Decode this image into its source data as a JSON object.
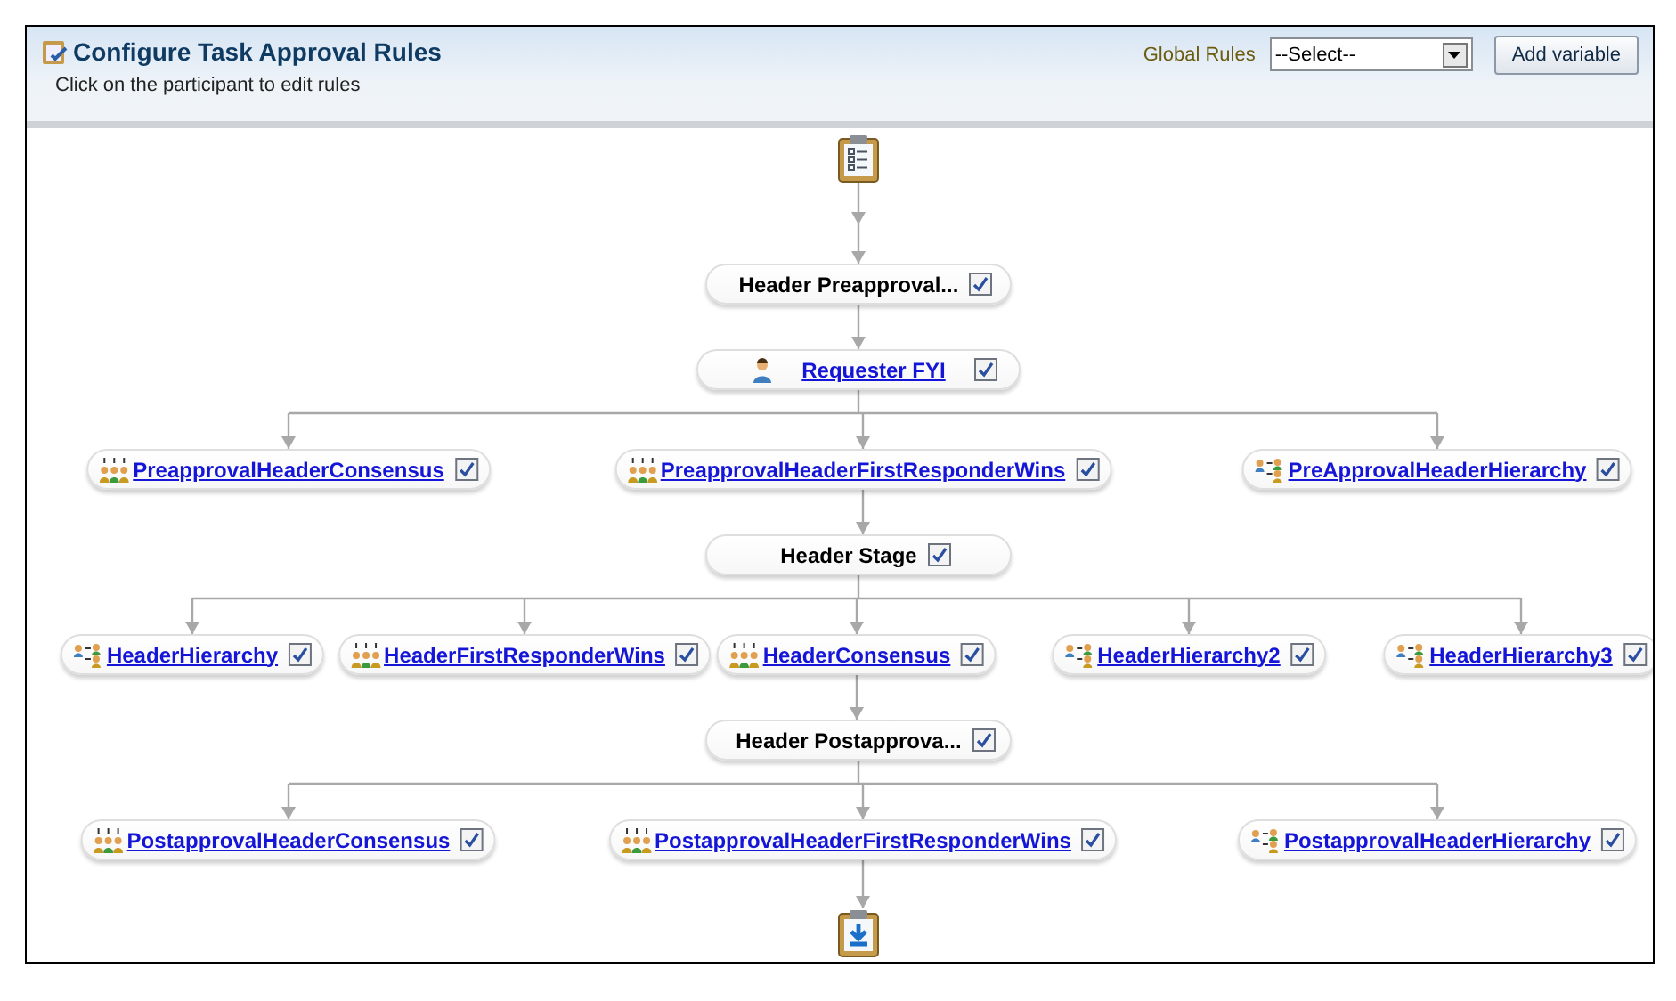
{
  "header": {
    "title": "Configure Task Approval Rules",
    "subtitle": "Click on the participant to edit rules",
    "global_rules": {
      "label": "Global Rules",
      "value": "--Select--"
    },
    "add_button": "Add variable"
  },
  "flow": [
    {
      "kind": "start"
    },
    {
      "kind": "stage",
      "label": "Header Preapproval...",
      "checked": true
    },
    {
      "kind": "participants",
      "items": [
        {
          "kind": "single",
          "label": "Requester FYI",
          "checked": true
        }
      ]
    },
    {
      "kind": "participants",
      "items": [
        {
          "kind": "parallel",
          "label": "PreapprovalHeaderConsensus",
          "checked": true
        },
        {
          "kind": "parallel",
          "label": "PreapprovalHeaderFirstResponderWins",
          "checked": true
        },
        {
          "kind": "hierarchy",
          "label": "PreApprovalHeaderHierarchy",
          "checked": true
        }
      ]
    },
    {
      "kind": "stage",
      "label": "Header Stage",
      "checked": true
    },
    {
      "kind": "participants",
      "items": [
        {
          "kind": "hierarchy",
          "label": "HeaderHierarchy",
          "checked": true
        },
        {
          "kind": "parallel",
          "label": "HeaderFirstResponderWins",
          "checked": true
        },
        {
          "kind": "parallel",
          "label": "HeaderConsensus",
          "checked": true
        },
        {
          "kind": "hierarchy",
          "label": "HeaderHierarchy2",
          "checked": true
        },
        {
          "kind": "hierarchy",
          "label": "HeaderHierarchy3",
          "checked": true
        }
      ]
    },
    {
      "kind": "stage",
      "label": "Header Postapprova...",
      "checked": true
    },
    {
      "kind": "participants",
      "items": [
        {
          "kind": "parallel",
          "label": "PostapprovalHeaderConsensus",
          "checked": true
        },
        {
          "kind": "parallel",
          "label": "PostapprovalHeaderFirstResponderWins",
          "checked": true
        },
        {
          "kind": "hierarchy",
          "label": "PostapprovalHeaderHierarchy",
          "checked": true
        }
      ]
    },
    {
      "kind": "end"
    }
  ]
}
